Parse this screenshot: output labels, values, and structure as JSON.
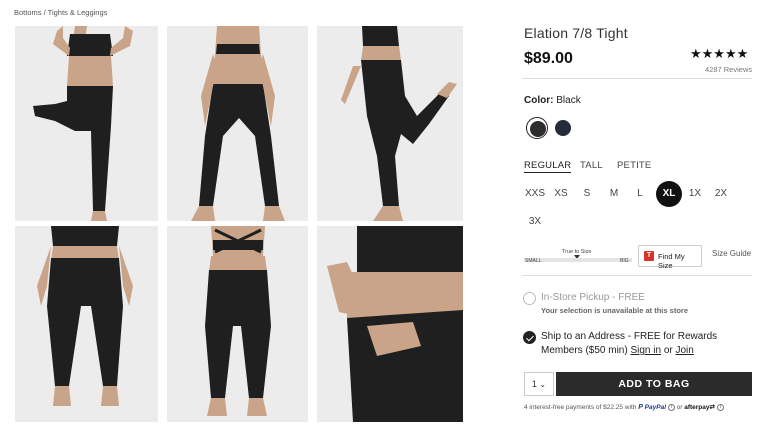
{
  "breadcrumb": {
    "item1": "Bottoms",
    "sep": " / ",
    "item2": "Tights & Leggings"
  },
  "product": {
    "title": "Elation 7/8 Tight",
    "price": "$89.00",
    "rating_stars": "★★★★★",
    "rating": 5,
    "reviews": "4287 Reviews"
  },
  "color": {
    "label": "Color:",
    "value": "Black",
    "swatches": [
      {
        "name": "Black",
        "hex": "#2d2d2d",
        "selected": true
      },
      {
        "name": "Navy",
        "hex": "#252b3b",
        "selected": false
      }
    ]
  },
  "fit_tabs": [
    {
      "label": "REGULAR",
      "active": true
    },
    {
      "label": "TALL",
      "active": false
    },
    {
      "label": "PETITE",
      "active": false
    }
  ],
  "sizes": [
    {
      "label": "XXS",
      "selected": false
    },
    {
      "label": "XS",
      "selected": false
    },
    {
      "label": "S",
      "selected": false
    },
    {
      "label": "M",
      "selected": false
    },
    {
      "label": "L",
      "selected": false
    },
    {
      "label": "XL",
      "selected": true
    },
    {
      "label": "1X",
      "selected": false
    },
    {
      "label": "2X",
      "selected": false
    },
    {
      "label": "3X",
      "selected": false
    }
  ],
  "true_to_size": {
    "label": "True to Size",
    "small": "SMALL",
    "big": "BIG"
  },
  "find_my_size": {
    "icon": "T",
    "label": "Find My Size"
  },
  "size_guide": "Size Guide",
  "pickup": {
    "title": "In-Store Pickup - FREE",
    "note": "Your selection is unavailable at this store",
    "checked": false
  },
  "ship": {
    "line1": "Ship to an Address - FREE for Rewards",
    "line2_prefix": "Members ($50 min) ",
    "sign_in": "Sign in",
    "or": " or ",
    "join": "Join",
    "checked": true
  },
  "cart": {
    "qty": "1",
    "qty_caret": "⌄",
    "add_label": "ADD TO BAG"
  },
  "payments": {
    "text": "4 interest-free payments of $22.25 with ",
    "paypal": "PayPal",
    "or": " or ",
    "afterpay": "afterpay",
    "afterpay_symbol": "⇄",
    "info": "i"
  },
  "colors": {
    "garment": "#1f1f1f",
    "skin": "#c9a488",
    "background": "#ebebeb",
    "brand_red": "#d6332a"
  }
}
